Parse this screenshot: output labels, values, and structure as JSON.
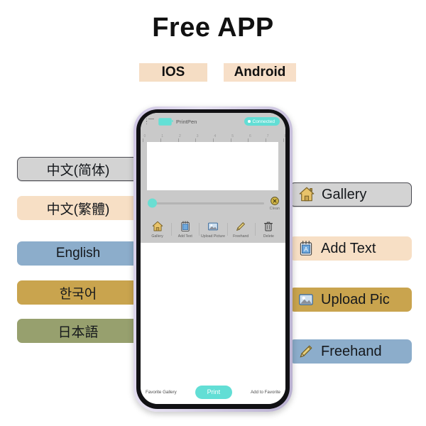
{
  "header": {
    "title": "Free APP",
    "platforms": [
      {
        "label": "IOS",
        "highlight": "#f5ddc4"
      },
      {
        "label": "Android",
        "highlight": "#f7dfc8"
      }
    ]
  },
  "languages": [
    {
      "label": "中文(简体)",
      "color": "#d3d3d3",
      "framed": true
    },
    {
      "label": "中文(繁體)",
      "color": "#f7dfc5",
      "framed": false
    },
    {
      "label": "English",
      "color": "#8cadcb",
      "framed": false
    },
    {
      "label": "한국어",
      "color": "#c9a44e",
      "framed": false
    },
    {
      "label": "日本語",
      "color": "#97a06e",
      "framed": false
    }
  ],
  "features": [
    {
      "label": "Gallery",
      "icon": "house-icon",
      "color": "#d3d3d3",
      "framed": true
    },
    {
      "label": "Add Text",
      "icon": "notepad-icon",
      "color": "#f7dfc5",
      "framed": false
    },
    {
      "label": "Upload Pic",
      "icon": "image-icon",
      "color": "#c9a44e",
      "framed": false
    },
    {
      "label": "Freehand",
      "icon": "pencil-icon",
      "color": "#8cadcb",
      "framed": false
    }
  ],
  "phone": {
    "app": {
      "menu_icon": "list-menu-icon",
      "battery_icon": "battery-icon",
      "name": "PrintPen",
      "status_badge": "Connected",
      "status_color": "#62ded5",
      "ruler": {
        "ticks": [
          "0",
          "1",
          "2",
          "3",
          "4",
          "5",
          "6",
          "7",
          "8"
        ]
      },
      "slider": {
        "value_percent": 0
      },
      "clean": {
        "label": "Clean",
        "icon": "circle-x-icon"
      },
      "toolbar": [
        {
          "label": "Gallery",
          "icon": "house-icon"
        },
        {
          "label": "Add Text",
          "icon": "notepad-icon"
        },
        {
          "label": "Upload Picture",
          "icon": "image-icon"
        },
        {
          "label": "Freehand",
          "icon": "pencil-icon"
        },
        {
          "label": "Delete",
          "icon": "trash-icon"
        }
      ],
      "bottom_bar": {
        "left_link": "Favorite Gallery",
        "print_button": "Print",
        "right_link": "Add to Favorite"
      }
    }
  }
}
